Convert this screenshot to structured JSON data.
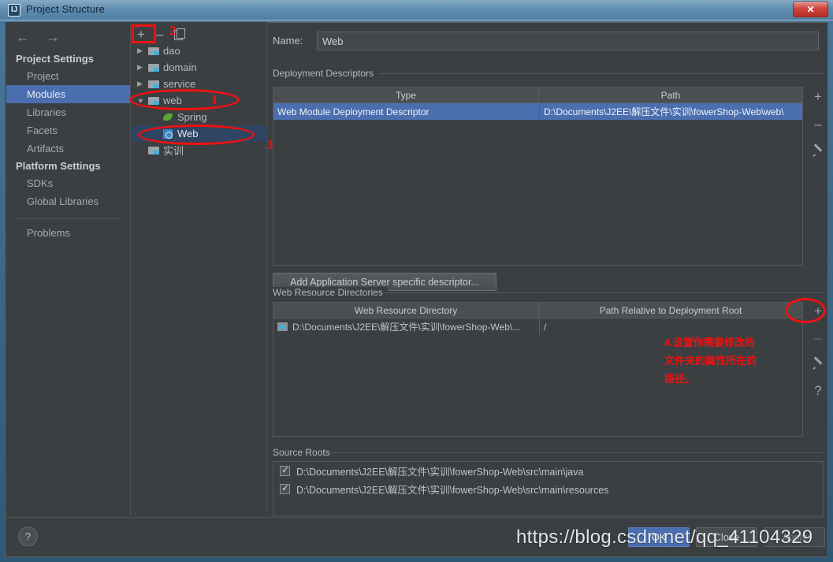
{
  "window": {
    "title": "Project Structure",
    "app_icon": "intellij-idea-icon",
    "close_label": "✕"
  },
  "sidebar": {
    "nav": {
      "back": "←",
      "forward": "→"
    },
    "groups": [
      {
        "label": "Project Settings",
        "items": [
          {
            "label": "Project",
            "selected": false
          },
          {
            "label": "Modules",
            "selected": true
          },
          {
            "label": "Libraries",
            "selected": false
          },
          {
            "label": "Facets",
            "selected": false
          },
          {
            "label": "Artifacts",
            "selected": false
          }
        ]
      },
      {
        "label": "Platform Settings",
        "items": [
          {
            "label": "SDKs",
            "selected": false
          },
          {
            "label": "Global Libraries",
            "selected": false
          }
        ]
      }
    ],
    "problems": "Problems"
  },
  "tree": {
    "toolbar": {
      "add": "+",
      "remove": "–",
      "copy": "copy-icon"
    },
    "nodes": [
      {
        "label": "dao",
        "icon": "folder-module-icon",
        "twisty": "▶",
        "indent": 0,
        "selected": false
      },
      {
        "label": "domain",
        "icon": "folder-module-icon",
        "twisty": "▶",
        "indent": 0,
        "selected": false
      },
      {
        "label": "service",
        "icon": "folder-module-icon",
        "twisty": "▶",
        "indent": 0,
        "selected": false
      },
      {
        "label": "web",
        "icon": "folder-module-icon",
        "twisty": "▼",
        "indent": 0,
        "selected": false
      },
      {
        "label": "Spring",
        "icon": "spring-facet-icon",
        "twisty": "",
        "indent": 1,
        "selected": false
      },
      {
        "label": "Web",
        "icon": "web-facet-icon",
        "twisty": "",
        "indent": 1,
        "selected": true
      },
      {
        "label": "实训",
        "icon": "folder-module-icon",
        "twisty": "",
        "indent": 0,
        "selected": false
      }
    ]
  },
  "content": {
    "name_label": "Name:",
    "name_value": "Web",
    "deployment": {
      "group_title": "Deployment Descriptors",
      "columns": [
        "Type",
        "Path"
      ],
      "rows": [
        {
          "type": "Web Module Deployment Descriptor",
          "path": "D:\\Documents\\J2EE\\解压文件\\实训\\fowerShop-Web\\web\\",
          "selected": true
        }
      ],
      "buttons": {
        "add": "+",
        "remove": "–",
        "edit": "pencil-icon"
      },
      "add_descriptor_button": "Add Application Server specific descriptor..."
    },
    "web_resources": {
      "group_title": "Web Resource Directories",
      "columns": [
        "Web Resource Directory",
        "Path Relative to Deployment Root"
      ],
      "rows": [
        {
          "directory": "D:\\Documents\\J2EE\\解压文件\\实训\\fowerShop-Web\\...",
          "relative": "/"
        }
      ],
      "buttons": {
        "add": "+",
        "remove": "–",
        "edit": "pencil-icon",
        "help": "?"
      }
    },
    "source_roots": {
      "group_title": "Source Roots",
      "rows": [
        {
          "path": "D:\\Documents\\J2EE\\解压文件\\实训\\fowerShop-Web\\src\\main\\java",
          "checked": true
        },
        {
          "path": "D:\\Documents\\J2EE\\解压文件\\实训\\fowerShop-Web\\src\\main\\resources",
          "checked": true
        }
      ]
    }
  },
  "bottom": {
    "help": "?",
    "ok": "OK",
    "close": "Close",
    "apply": "Apply"
  },
  "annotations": {
    "color": "#ee1111",
    "num1": "1",
    "num2": "2",
    "num3": "3",
    "note4_line1": "4.设置你需要修改的",
    "note4_line2": "文件夹的属性所在的",
    "note4_line3": "路径。"
  },
  "watermark": "https://blog.csdn.net/qq_41104329"
}
